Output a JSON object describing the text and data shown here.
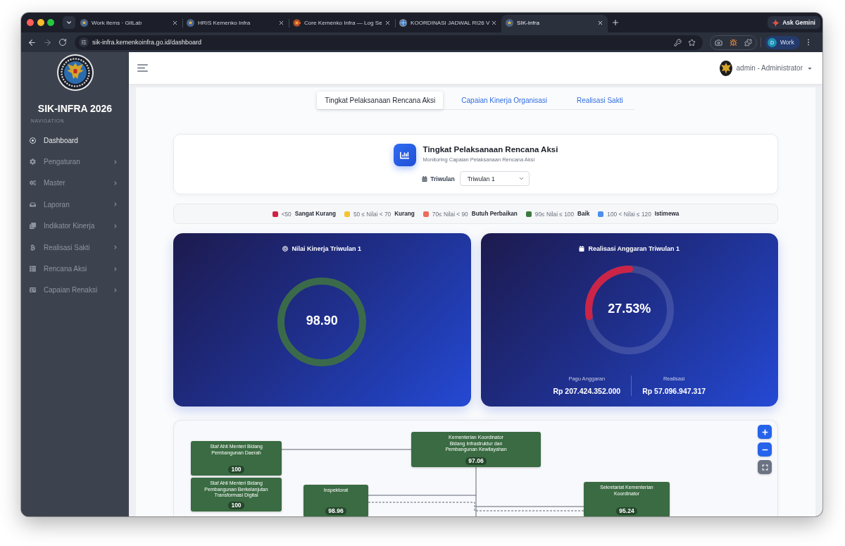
{
  "browser": {
    "tabs": [
      {
        "title": "Work items · GitLab",
        "selected": false
      },
      {
        "title": "HRIS Kemenko Infra",
        "selected": false
      },
      {
        "title": "Core Kemenko Infra — Log Se",
        "selected": false
      },
      {
        "title": "KOORDINASI JADWAL RI26 V",
        "selected": false
      },
      {
        "title": "SIK-Infra",
        "selected": true
      }
    ],
    "gemini": "Ask Gemini",
    "url": "sik-infra.kemenkoinfra.go.id/dashboard",
    "profile": {
      "initial": "D",
      "name": "Work"
    }
  },
  "sidebar": {
    "title": "SIK-INFRA 2026",
    "section": "NAVIGATION",
    "items": [
      {
        "label": "Dashboard",
        "kind": "link",
        "selected": true
      },
      {
        "label": "Pengaturan",
        "kind": "submenu",
        "selected": false
      },
      {
        "label": "Master",
        "kind": "submenu",
        "selected": false
      },
      {
        "label": "Laporan",
        "kind": "submenu",
        "selected": false
      },
      {
        "label": "Indikator Kinerja",
        "kind": "submenu",
        "selected": false
      },
      {
        "label": "Realisasi Sakti",
        "kind": "submenu",
        "selected": false
      },
      {
        "label": "Rencana Aksi",
        "kind": "submenu",
        "selected": false
      },
      {
        "label": "Capaian Renaksi",
        "kind": "submenu",
        "selected": false
      }
    ]
  },
  "header": {
    "user": "admin - Administrator"
  },
  "page_tabs": [
    {
      "label": "Tingkat Pelaksanaan Rencana Aksi",
      "selected": true
    },
    {
      "label": "Capaian Kinerja Organisasi",
      "selected": false
    },
    {
      "label": "Realisasi Sakti",
      "selected": false
    }
  ],
  "summary": {
    "title": "Tingkat Pelaksanaan Rencana Aksi",
    "subtitle": "Monitoring Capaian Pelaksanaan Rencana Aksi",
    "filter": {
      "label": "Triwulan",
      "value": "Triwulan 1"
    }
  },
  "legend": [
    {
      "range": "<50",
      "label": "Sangat Kurang",
      "color": "#cf2242"
    },
    {
      "range": "50 ≤ Nilai < 70",
      "label": "Kurang",
      "color": "#f3c530"
    },
    {
      "range": "70≤ Nilai < 90",
      "label": "Butuh Perbaikan",
      "color": "#ef6b5b"
    },
    {
      "range": "90≤ Nilai ≤ 100",
      "label": "Baik",
      "color": "#3a7a3f"
    },
    {
      "range": "100 < Nilai ≤ 120",
      "label": "Istimewa",
      "color": "#4b8ff0"
    }
  ],
  "cards": [
    {
      "kind": "score",
      "title": "Nilai Kinerja Triwulan 1",
      "value": "98.90",
      "color": "#3b6a4b"
    },
    {
      "kind": "budget",
      "title": "Realisasi Anggaran Triwulan 1",
      "value": "27.53%",
      "level": 0.2753,
      "color": "#cc2447",
      "stats": [
        {
          "label": "Pagu Anggaran",
          "value": "Rp 207.424.352.000"
        },
        {
          "label": "Realisasi",
          "value": "Rp 57.096.947.317"
        }
      ]
    }
  ],
  "org_chart": {
    "nodes": [
      {
        "name": "Staf Ahli Menteri Bidang Pembangunan Daerah",
        "value": "100"
      },
      {
        "name": "Staf Ahli Menteri Bidang Pembangunan Berkelanjutan Transformasi Digital",
        "value": "100"
      },
      {
        "name": "Kementerian Koordinator Bidang Infrastruktur dan Pembangunan Kewilayahan",
        "value": "97.06"
      },
      {
        "name": "Inspektorat",
        "value": "98.96"
      },
      {
        "name": "Sekretariat Kementerian Koordinator",
        "value": "95.24"
      }
    ]
  }
}
